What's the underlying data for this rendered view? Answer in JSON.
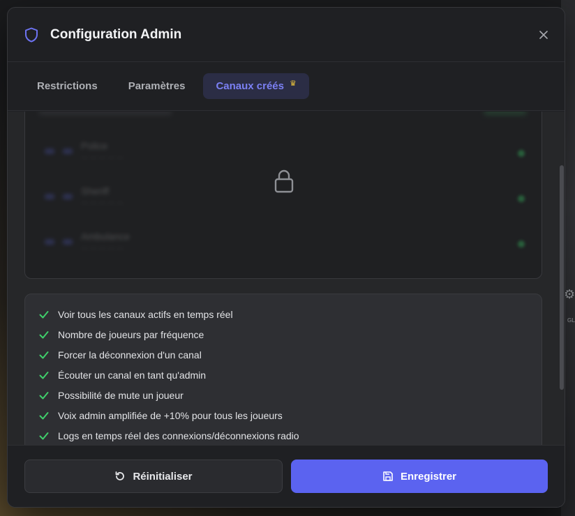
{
  "modal": {
    "title": "Configuration Admin",
    "header_icon": "shield-icon",
    "close_icon": "close-icon"
  },
  "tabs": [
    {
      "label": "Restrictions",
      "active": false
    },
    {
      "label": "Paramètres",
      "active": false
    },
    {
      "label": "Canaux créés",
      "active": true,
      "badge_icon": "crown-icon"
    }
  ],
  "locked_preview": {
    "icon": "lock-icon",
    "rows": [
      "Police",
      "Sheriff",
      "Ambulance"
    ]
  },
  "features": [
    "Voir tous les canaux actifs en temps réel",
    "Nombre de joueurs par fréquence",
    "Forcer la déconnexion d'un canal",
    "Écouter un canal en tant qu'admin",
    "Possibilité de mute un joueur",
    "Voix admin amplifiée de +10% pour tous les joueurs",
    "Logs en temps réel des connexions/déconnexions radio"
  ],
  "footer": {
    "reset_label": "Réinitialiser",
    "save_label": "Enregistrer"
  },
  "colors": {
    "accent": "#5b63f0",
    "active_tab_text": "#7b80f4",
    "check_green": "#3fcf6b",
    "crown_gold": "#e9c23a"
  }
}
